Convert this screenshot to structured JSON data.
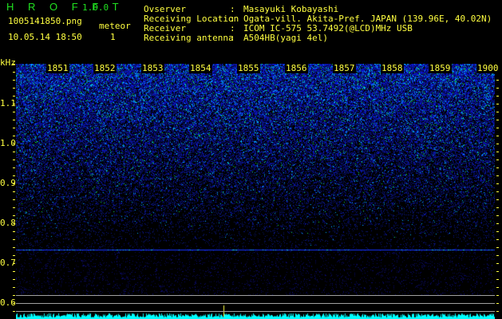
{
  "app": {
    "name": "H R O F F T",
    "version": "1.0.0"
  },
  "file": {
    "name": "1005141850.png",
    "datetime": "10.05.14 18:50"
  },
  "meteor": {
    "label": "meteor",
    "count": "1"
  },
  "info": [
    {
      "label": "Ovserver",
      "value": "Masayuki Kobayashi"
    },
    {
      "label": "Receiving Location",
      "value": "Ogata-vill. Akita-Pref. JAPAN (139.96E, 40.02N)"
    },
    {
      "label": "Receiver",
      "value": "ICOM IC-575 53.7492(@LCD)MHz USB"
    },
    {
      "label": "Receiving antenna",
      "value": "A504HB(yagi 4el)"
    }
  ],
  "separator": ":",
  "axis": {
    "unit": "kHz",
    "y_labels": [
      "1.1",
      "1.0",
      "0.9",
      "0.8",
      "0.7",
      "0.6"
    ],
    "time_labels": [
      "1851",
      "1852",
      "1853",
      "1854",
      "1855",
      "1856",
      "1857",
      "1858",
      "1859",
      "1900"
    ]
  },
  "signal": {
    "carrier_khz": 0.74,
    "meteor_time_fraction": 0.42
  },
  "colors": {
    "text": "#ffff40",
    "title": "#20e020",
    "spectrum": "#00ffff",
    "carrier": "#2040ff"
  }
}
